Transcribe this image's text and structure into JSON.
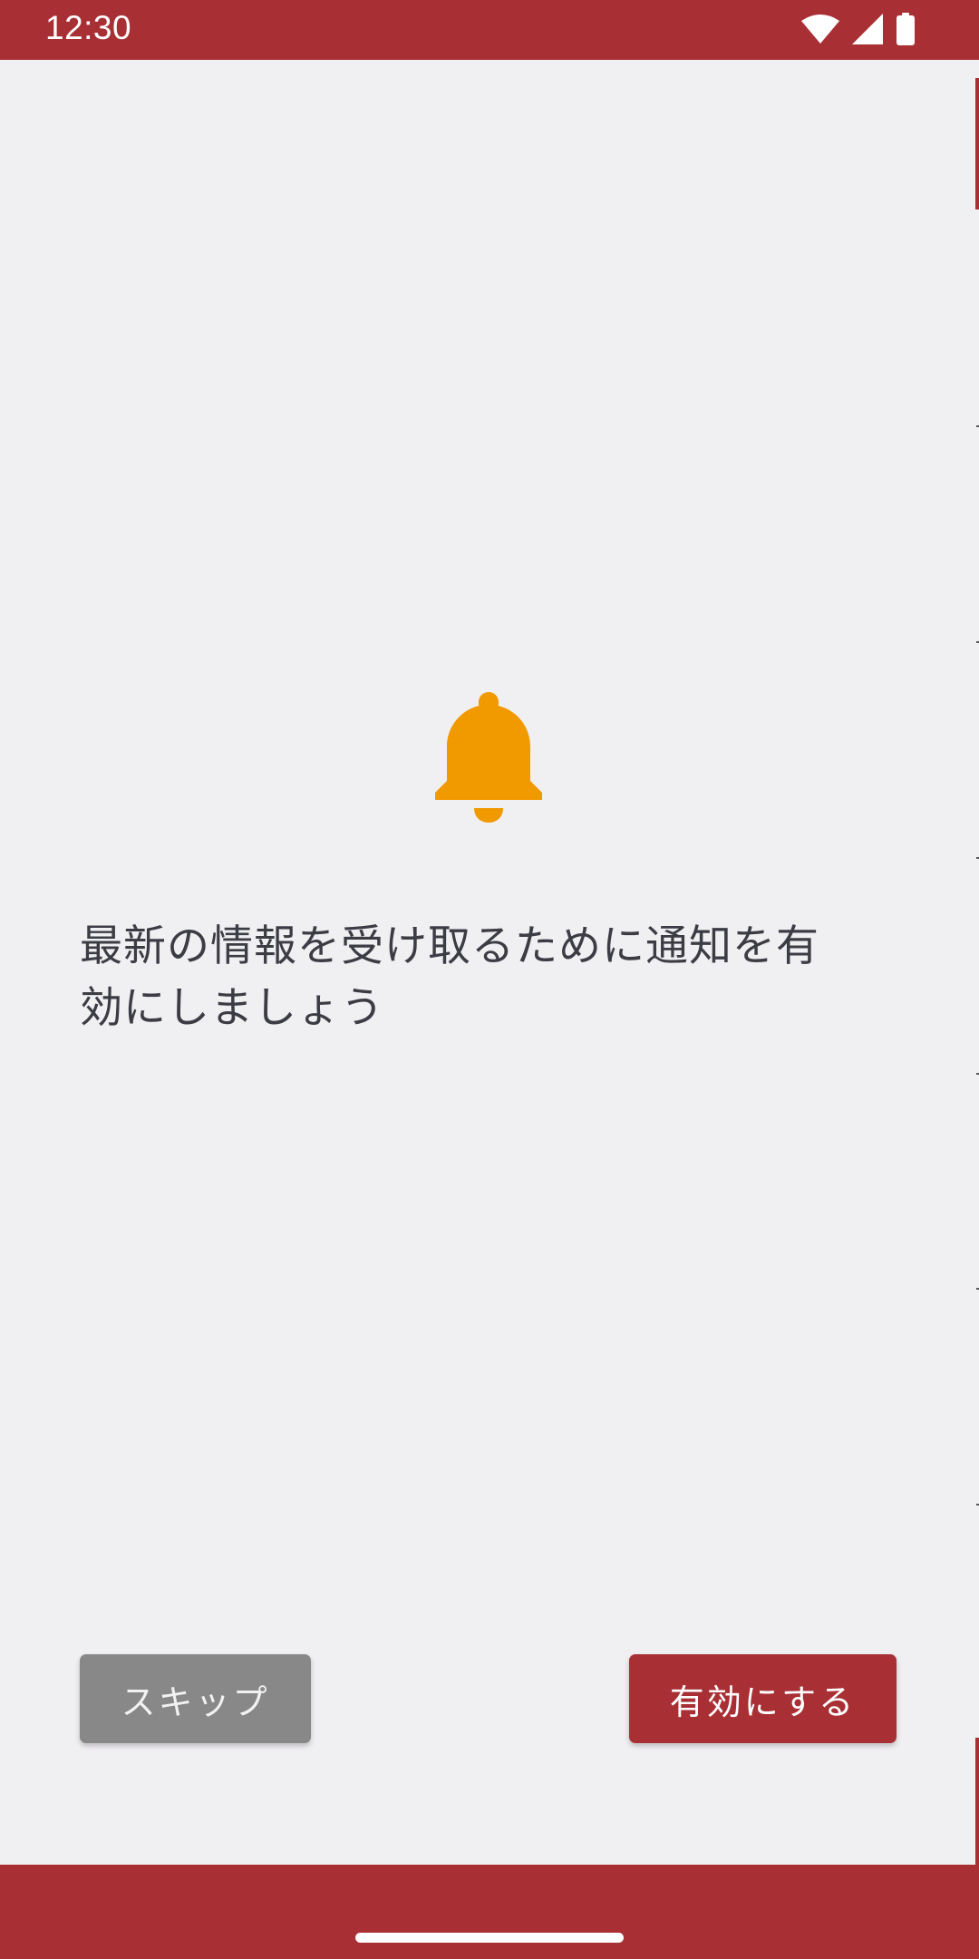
{
  "status_bar": {
    "time": "12:30",
    "icons": [
      "wifi-icon",
      "cellular-signal-icon",
      "battery-icon"
    ]
  },
  "main": {
    "icon": "bell-icon",
    "message_line1": "最新の情報を受け取るために通知を有",
    "message_line2": "効にしましょう"
  },
  "buttons": {
    "skip_label": "スキップ",
    "enable_label": "有効にする"
  },
  "colors": {
    "primary": "#a83035",
    "background": "#f0eff2",
    "bell": "#f09a00",
    "skip_button": "#888888",
    "text": "#3c3c44"
  }
}
